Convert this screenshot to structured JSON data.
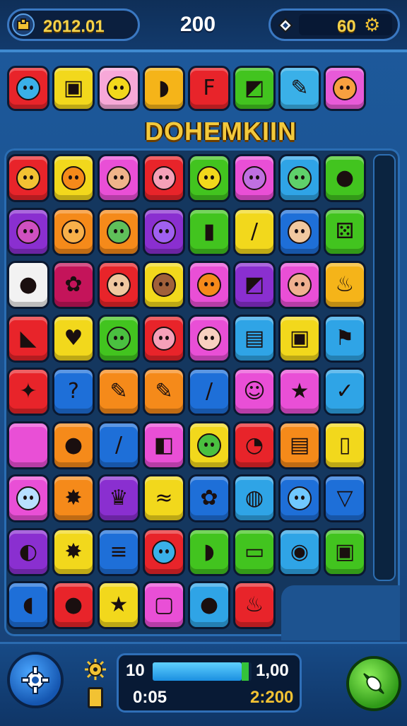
{
  "header": {
    "coins_value": "2012.01",
    "score_value": "200",
    "gems_value": "60"
  },
  "level_title": "DOHEMKIIN",
  "goal_tiles": [
    {
      "color": "#e8242a",
      "icon": "blue-creature-icon"
    },
    {
      "color": "#f2d81c",
      "icon": "green-box-icon"
    },
    {
      "color": "#f7a8d8",
      "icon": "yellow-monster-icon"
    },
    {
      "color": "#f5b419",
      "icon": "red-chili-icon"
    },
    {
      "color": "#e8242a",
      "icon": "letter-f-icon"
    },
    {
      "color": "#42c41f",
      "icon": "red-robot-icon"
    },
    {
      "color": "#3ab0e8",
      "icon": "pencil-icon"
    },
    {
      "color": "#e85ad8",
      "icon": "orange-critter-icon"
    }
  ],
  "board": {
    "rows": [
      [
        {
          "color": "#e8242a",
          "icon": "corn-face-icon"
        },
        {
          "color": "#f2d81c",
          "icon": "orange-face-icon"
        },
        {
          "color": "#e94fd6",
          "icon": "boy-face-icon"
        },
        {
          "color": "#e8242a",
          "icon": "pink-face-icon"
        },
        {
          "color": "#42c41f",
          "icon": "yellow-face-icon"
        },
        {
          "color": "#e94fd6",
          "icon": "purple-face-icon"
        },
        {
          "color": "#2fa4e6",
          "icon": "green-face-icon"
        },
        {
          "color": "#42c41f",
          "icon": "apple-icon"
        }
      ],
      [
        {
          "color": "#8a2fd0",
          "icon": "purple-critter-icon"
        },
        {
          "color": "#f58a1a",
          "icon": "fox-face-icon"
        },
        {
          "color": "#f58a1a",
          "icon": "goblin-face-icon"
        },
        {
          "color": "#8a2fd0",
          "icon": "purple-blob-icon"
        },
        {
          "color": "#42c41f",
          "icon": "bottle-icon"
        },
        {
          "color": "#f2d81c",
          "icon": "crayon-icon"
        },
        {
          "color": "#1e6fd8",
          "icon": "bald-face-icon"
        },
        {
          "color": "#42c41f",
          "icon": "dice-icon"
        }
      ],
      [
        {
          "color": "#f2f2f2",
          "icon": "purple-drop-icon"
        },
        {
          "color": "#c4145a",
          "icon": "flower-icon"
        },
        {
          "color": "#e8242a",
          "icon": "elf-face-icon"
        },
        {
          "color": "#f2d81c",
          "icon": "brown-face-icon"
        },
        {
          "color": "#e94fd6",
          "icon": "orange-face-icon"
        },
        {
          "color": "#8a2fd0",
          "icon": "robot-icon"
        },
        {
          "color": "#e94fd6",
          "icon": "cap-face-icon"
        },
        {
          "color": "#f5b419",
          "icon": "flame-icon"
        }
      ],
      [
        {
          "color": "#e8242a",
          "icon": "bird-icon"
        },
        {
          "color": "#f2d81c",
          "icon": "strawberry-icon"
        },
        {
          "color": "#42c41f",
          "icon": "frog-face-icon"
        },
        {
          "color": "#e8242a",
          "icon": "pink-face-icon"
        },
        {
          "color": "#e94fd6",
          "icon": "cat-face-icon"
        },
        {
          "color": "#2fa4e6",
          "icon": "cake-icon"
        },
        {
          "color": "#f2d81c",
          "icon": "gift-icon"
        },
        {
          "color": "#2fa4e6",
          "icon": "flag-icon"
        }
      ],
      [
        {
          "color": "#e8242a",
          "icon": "feather-icon"
        },
        {
          "color": "#1e6fd8",
          "icon": "question-icon"
        },
        {
          "color": "#f58a1a",
          "icon": "note-icon"
        },
        {
          "color": "#f58a1a",
          "icon": "pencil-icon"
        },
        {
          "color": "#1e6fd8",
          "icon": "brush-icon"
        },
        {
          "color": "#e94fd6",
          "icon": "smile-icon"
        },
        {
          "color": "#e94fd6",
          "icon": "star-icon"
        },
        {
          "color": "#2fa4e6",
          "icon": "check-box-icon"
        }
      ],
      [
        {
          "color": "#e94fd6",
          "icon": "blank-icon"
        },
        {
          "color": "#f58a1a",
          "icon": "tomato-icon"
        },
        {
          "color": "#1e6fd8",
          "icon": "crayon-icon"
        },
        {
          "color": "#e94fd6",
          "icon": "bag-icon"
        },
        {
          "color": "#f2d81c",
          "icon": "monster-icon"
        },
        {
          "color": "#e8242a",
          "icon": "speech-icon"
        },
        {
          "color": "#f58a1a",
          "icon": "ticket-icon"
        },
        {
          "color": "#f2d81c",
          "icon": "battery-icon"
        }
      ],
      [
        {
          "color": "#e94fd6",
          "icon": "cloud-face-icon"
        },
        {
          "color": "#f58a1a",
          "icon": "turtle-icon"
        },
        {
          "color": "#8a2fd0",
          "icon": "crown-icon"
        },
        {
          "color": "#f2d81c",
          "icon": "bacon-icon"
        },
        {
          "color": "#1e6fd8",
          "icon": "grapes-icon"
        },
        {
          "color": "#2fa4e6",
          "icon": "potion-icon"
        },
        {
          "color": "#1e6fd8",
          "icon": "alien-face-icon"
        },
        {
          "color": "#1e6fd8",
          "icon": "cup-icon"
        }
      ],
      [
        {
          "color": "#8a2fd0",
          "icon": "blue-swirl-icon"
        },
        {
          "color": "#f2d81c",
          "icon": "bug-icon"
        },
        {
          "color": "#1e6fd8",
          "icon": "list-icon"
        },
        {
          "color": "#e8242a",
          "icon": "blue-creature-icon"
        },
        {
          "color": "#42c41f",
          "icon": "chili-icon"
        },
        {
          "color": "#42c41f",
          "icon": "book-icon"
        },
        {
          "color": "#2fa4e6",
          "icon": "pin-icon"
        },
        {
          "color": "#42c41f",
          "icon": "card-icon"
        }
      ],
      [
        {
          "color": "#1e6fd8",
          "icon": "pickle-icon"
        },
        {
          "color": "#e8242a",
          "icon": "pink-drop-icon"
        },
        {
          "color": "#f2d81c",
          "icon": "star-icon"
        },
        {
          "color": "#e94fd6",
          "icon": "phone-icon"
        },
        {
          "color": "#2fa4e6",
          "icon": "onion-icon"
        },
        {
          "color": "#e8242a",
          "icon": "fire-icon"
        }
      ]
    ]
  },
  "bottom": {
    "moves_label": "10",
    "target_value": "1,00",
    "time_value": "0:05",
    "best_value": "2:200",
    "progress_fraction": 0.9
  }
}
